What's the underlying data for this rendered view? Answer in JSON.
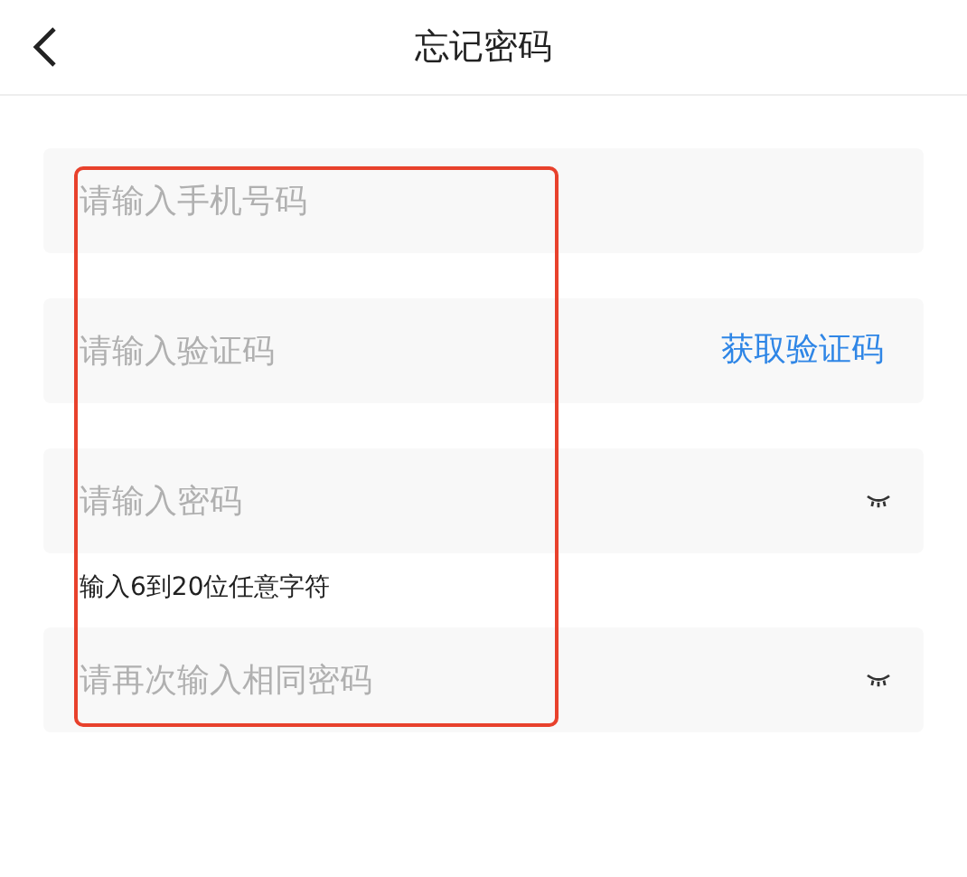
{
  "header": {
    "title": "忘记密码"
  },
  "fields": [
    {
      "kind": "plain",
      "placeholder": "请输入手机号码"
    },
    {
      "kind": "code",
      "placeholder": "请输入验证码",
      "action": "获取验证码"
    },
    {
      "kind": "password",
      "placeholder": "请输入密码",
      "hint": "输入6到20位任意字符"
    },
    {
      "kind": "password",
      "placeholder": "请再次输入相同密码"
    }
  ],
  "annotation": {
    "kind": "highlight-frame"
  }
}
